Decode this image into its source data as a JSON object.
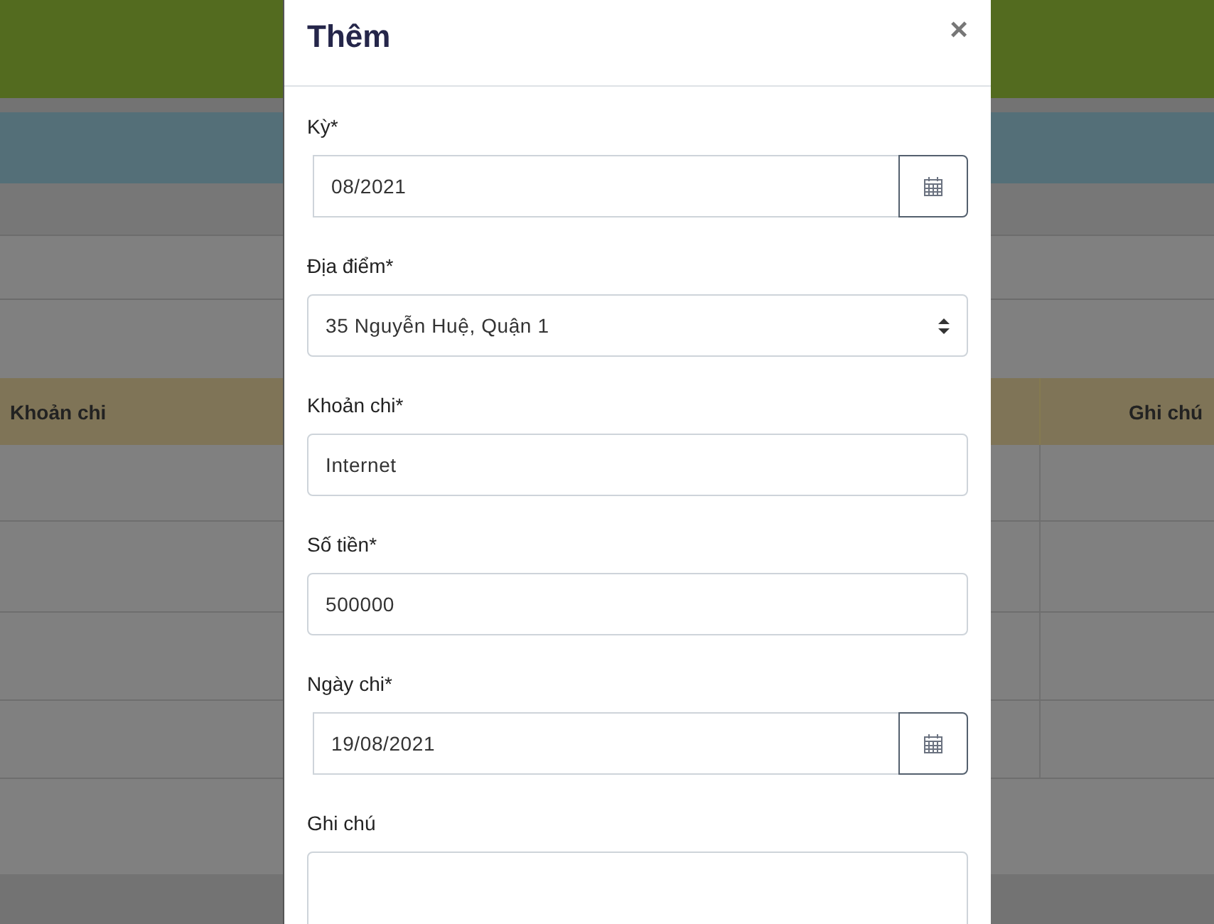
{
  "background": {
    "table": {
      "columns": [
        {
          "label": "Khoản chi"
        },
        {
          "label": "Ghi chú"
        }
      ]
    }
  },
  "modal": {
    "title": "Thêm",
    "close": "×",
    "fields": [
      {
        "kind": "date",
        "label": "Kỳ*",
        "value": "08/2021"
      },
      {
        "kind": "select",
        "label": "Địa điểm*",
        "value": "35 Nguyễn Huệ, Quận 1"
      },
      {
        "kind": "text",
        "label": "Khoản chi*",
        "value": "Internet"
      },
      {
        "kind": "text",
        "label": "Số tiền*",
        "value": "500000"
      },
      {
        "kind": "date",
        "label": "Ngày chi*",
        "value": "19/08/2021"
      },
      {
        "kind": "textarea",
        "label": "Ghi chú"
      }
    ]
  }
}
